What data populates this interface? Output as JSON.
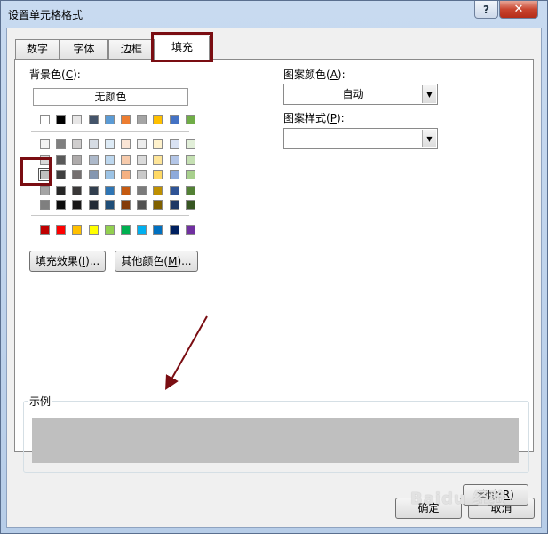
{
  "window": {
    "title": "设置单元格格式",
    "help_label": "?",
    "close_label": "✕"
  },
  "tabs": [
    {
      "label": "数字",
      "active": false
    },
    {
      "label": "字体",
      "active": false
    },
    {
      "label": "边框",
      "active": false
    },
    {
      "label": "填充",
      "active": true
    }
  ],
  "fill": {
    "background_color_label": "背景色",
    "background_color_hotkey": "C",
    "no_color_label": "无颜色",
    "theme_rows": [
      [
        "#ffffff",
        "#000000",
        "#eeece1",
        "#1f497d",
        "#4f81bd",
        "#c0504d",
        "#9bbb59",
        "#8064a2",
        "#4bacc6",
        "#f79646"
      ],
      [
        "#f2f2f2",
        "#808080",
        "#ddd9c3",
        "#c6d9f0",
        "#dbe5f1",
        "#f2dcdb",
        "#ebf1dd",
        "#e5e0ec",
        "#dbeef3",
        "#fdeada"
      ]
    ],
    "top_row": [
      "#ffffff",
      "#000000",
      "#e7e6e6",
      "#44546a",
      "#5b9bd5",
      "#ed7d31",
      "#a5a5a5",
      "#ffc000",
      "#4472c4",
      "#70ad47"
    ],
    "shade_rows": [
      [
        "#f2f2f2",
        "#7f7f7f",
        "#d0cece",
        "#d6dce4",
        "#deebf6",
        "#fbe5d5",
        "#ededed",
        "#fff2cc",
        "#d9e2f3",
        "#e2efd9"
      ],
      [
        "#d8d8d8",
        "#595959",
        "#aeabab",
        "#adb9ca",
        "#bdd7ee",
        "#f7cbac",
        "#dbdbdb",
        "#fee599",
        "#b4c6e7",
        "#c5e0b3"
      ],
      [
        "#bfbfbf",
        "#3f3f3f",
        "#757070",
        "#8496b0",
        "#9cc3e5",
        "#f4b183",
        "#c9c9c9",
        "#ffd965",
        "#8eaadb",
        "#a8d08d"
      ],
      [
        "#a5a5a5",
        "#262626",
        "#3a3838",
        "#323f4f",
        "#2e75b5",
        "#c55a11",
        "#7b7b7b",
        "#bf9000",
        "#2f5496",
        "#538135"
      ],
      [
        "#7f7f7f",
        "#0c0c0c",
        "#171616",
        "#222a35",
        "#1f4e79",
        "#843c0b",
        "#525252",
        "#7f6000",
        "#1f3864",
        "#375623"
      ]
    ],
    "standard_row": [
      "#c00000",
      "#ff0000",
      "#ffc000",
      "#ffff00",
      "#92d050",
      "#00b050",
      "#00b0f0",
      "#0070c0",
      "#002060",
      "#7030a0"
    ],
    "selected_color": "#bfbfbf",
    "fill_effects_label": "填充效果",
    "fill_effects_hotkey": "I",
    "more_colors_label": "其他颜色",
    "more_colors_hotkey": "M",
    "pattern_color_label": "图案颜色",
    "pattern_color_hotkey": "A",
    "pattern_color_value": "自动",
    "pattern_style_label": "图案样式",
    "pattern_style_hotkey": "P",
    "pattern_style_value": "",
    "sample_label": "示例",
    "clear_label": "清除",
    "clear_hotkey": "R"
  },
  "footer": {
    "ok_label": "确定",
    "cancel_label": "取消"
  },
  "watermark": "Baidu 经验",
  "colors": {
    "annotation": "#7a0d12"
  }
}
